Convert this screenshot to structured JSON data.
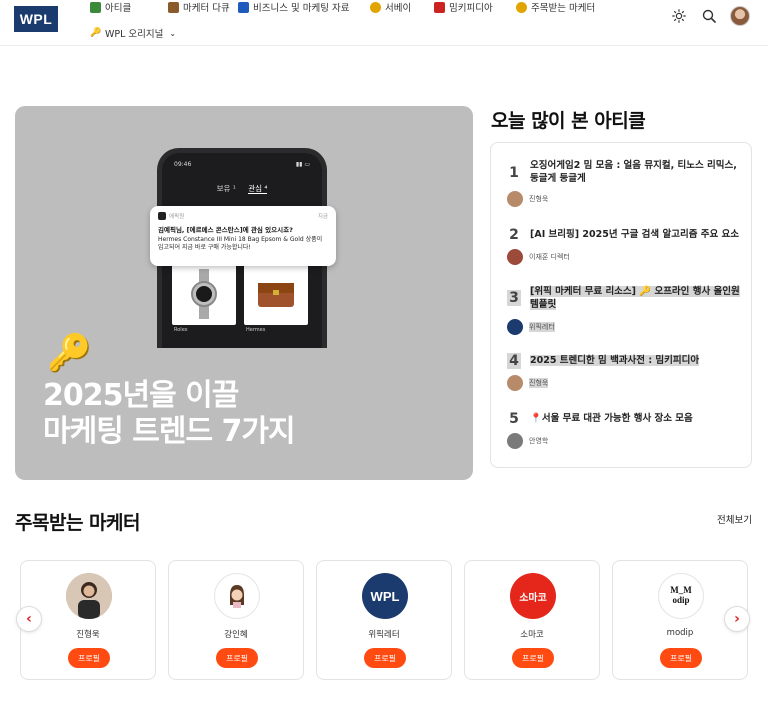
{
  "header": {
    "logo_text": "WPL",
    "nav": [
      {
        "label": "아티클",
        "icon": "notebook-icon",
        "color": "#3a8a3a"
      },
      {
        "label": "마케터 다큐",
        "icon": "film-icon",
        "color": "#8a5a2a"
      },
      {
        "label": "비즈니스 및 마케팅 자료",
        "icon": "tag-icon",
        "color": "#1e5bbd"
      },
      {
        "label": "서베이",
        "icon": "smile-icon",
        "color": "#e2a400"
      },
      {
        "label": "밈키피디아",
        "icon": "megaphone-icon",
        "color": "#cc2222"
      },
      {
        "label": "주목받는 마케터",
        "icon": "sunglasses-icon",
        "color": "#e2a400"
      },
      {
        "label": "WPL 오리지널",
        "icon": "key-icon",
        "color": "#d49a00"
      }
    ]
  },
  "hero": {
    "title_line1": "2025년을 이끌",
    "title_line2": "마케팅 트렌드 7가지",
    "phone_time": "09:46",
    "phone_tab1": "보유 ¹",
    "phone_tab2": "관심 ⁴",
    "notif_app": "에픽원",
    "notif_time": "지금",
    "notif_title": "김예픽님, [에르메스 콘스탄스]에 관심 있으시죠?",
    "notif_body": "Hermes Constance III Mini 18 Bag Epsom & Gold 상품이 입고되어 지금 바로 구매 가능합니다!",
    "product1": "Rolex",
    "product2": "Hermes"
  },
  "popular": {
    "title": "오늘 많이 본 아티클",
    "items": [
      {
        "num": "1",
        "title": "오징어게임2 밈 모음 : 얼음 뮤지컬, 티노스 리믹스, 둥글게 둥글게",
        "author": "진형욱",
        "av_color": "#b78a6a"
      },
      {
        "num": "2",
        "title": "[AI 브리핑] 2025년 구글 검색 알고리즘 주요 요소",
        "author": "이재훈 디렉터",
        "av_color": "#9c4a3a"
      },
      {
        "num": "3",
        "title": "[위픽 마케터 무료 리소스] 🔑 오프라인 행사 올인원 템플릿",
        "author": "위픽레터",
        "av_color": "#1b3a6d"
      },
      {
        "num": "4",
        "title": "2025 트렌디한 밈 백과사전 : 밈키피디아",
        "author": "진형욱",
        "av_color": "#b78a6a"
      },
      {
        "num": "5",
        "title": "📍서울 무료 대관 가능한 행사 장소 모음",
        "author": "안영학",
        "av_color": "#7a7a7a"
      }
    ]
  },
  "featured": {
    "title": "주목받는 마케터",
    "see_all": "전체보기",
    "button_label": "프로필",
    "cards": [
      {
        "name": "진형욱",
        "avatar_text": "",
        "bg": "#c9b3a0",
        "fg": "#fff"
      },
      {
        "name": "강인혜",
        "avatar_text": "",
        "bg": "#ffffff",
        "fg": "#333"
      },
      {
        "name": "위픽레터",
        "avatar_text": "WPL",
        "bg": "#1b3a6d",
        "fg": "#ffffff"
      },
      {
        "name": "소마코",
        "avatar_text": "소마코",
        "bg": "#e5261b",
        "fg": "#ffffff"
      },
      {
        "name": "modip",
        "avatar_text": "M_M odip",
        "bg": "#ffffff",
        "fg": "#111"
      }
    ]
  },
  "accent": "#ff4b12"
}
